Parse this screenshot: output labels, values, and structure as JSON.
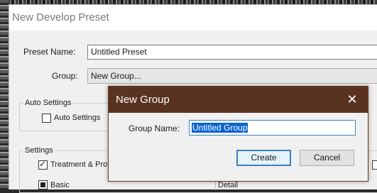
{
  "main_dialog": {
    "title": "New Develop Preset",
    "preset_name_label": "Preset Name:",
    "preset_name_value": "Untitled Preset",
    "group_label": "Group:",
    "group_value": "New Group...",
    "auto_settings_section": "Auto Settings",
    "auto_settings_checkbox": "Auto Settings",
    "settings_section": "Settings",
    "treatment_checkbox": "Treatment & Prof",
    "basic_checkbox": "Basic",
    "detail_label": "Detail"
  },
  "new_group_dialog": {
    "title": "New Group",
    "group_name_label": "Group Name:",
    "group_name_value": "Untitled Group",
    "create_button": "Create",
    "cancel_button": "Cancel",
    "close_icon": "close-icon"
  },
  "colors": {
    "modal_titlebar": "#5a3320",
    "selection": "#0a64d0",
    "primary_border": "#3c7fc0"
  }
}
